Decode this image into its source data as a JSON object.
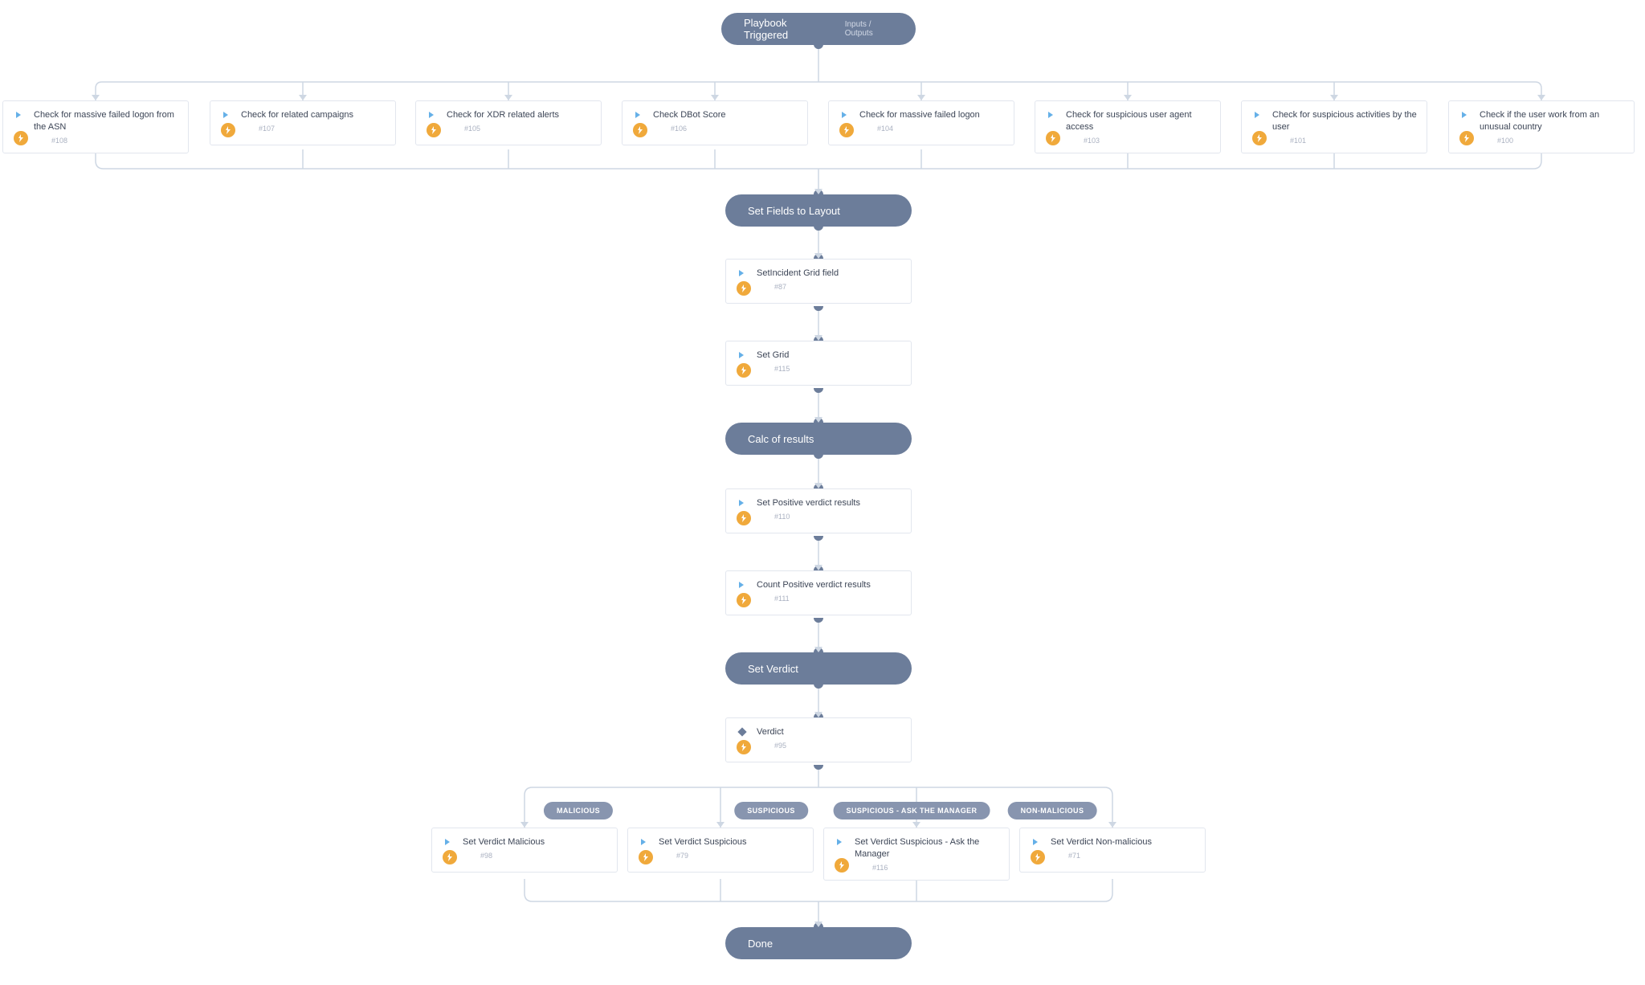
{
  "header": {
    "title": "Playbook Triggered",
    "sub": "Inputs / Outputs"
  },
  "row1": [
    {
      "title": "Check for massive failed logon from the ASN",
      "id": "#108"
    },
    {
      "title": "Check for related campaigns",
      "id": "#107"
    },
    {
      "title": "Check for XDR related alerts",
      "id": "#105"
    },
    {
      "title": "Check DBot Score",
      "id": "#106"
    },
    {
      "title": "Check for massive failed logon",
      "id": "#104"
    },
    {
      "title": "Check for suspicious user agent access",
      "id": "#103"
    },
    {
      "title": "Check for suspicious activities by the user",
      "id": "#101"
    },
    {
      "title": "Check if the user work from an unusual country",
      "id": "#100"
    }
  ],
  "sections": {
    "s1": "Set Fields to Layout",
    "s2": "Calc of results",
    "s3": "Set Verdict",
    "done": "Done"
  },
  "mid": [
    {
      "title": "SetIncident Grid field",
      "id": "#87"
    },
    {
      "title": "Set Grid",
      "id": "#115"
    },
    {
      "title": "Set Positive verdict results",
      "id": "#110"
    },
    {
      "title": "Count Positive verdict results",
      "id": "#111"
    }
  ],
  "verdict": {
    "title": "Verdict",
    "id": "#95"
  },
  "branches": [
    {
      "label": "MALICIOUS"
    },
    {
      "label": "SUSPICIOUS"
    },
    {
      "label": "SUSPICIOUS - ASK THE MANAGER"
    },
    {
      "label": "NON-MALICIOUS"
    }
  ],
  "row2": [
    {
      "title": "Set Verdict Malicious",
      "id": "#98"
    },
    {
      "title": "Set Verdict Suspicious",
      "id": "#79"
    },
    {
      "title": "Set Verdict Suspicious - Ask the Manager",
      "id": "#116"
    },
    {
      "title": "Set Verdict Non-malicious",
      "id": "#71"
    }
  ]
}
